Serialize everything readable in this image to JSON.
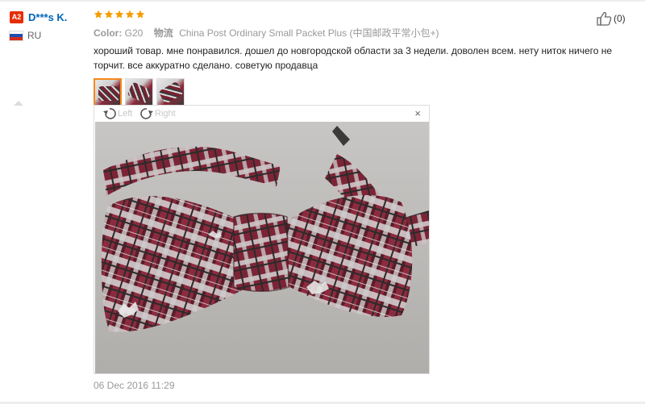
{
  "user": {
    "level_badge": "A2",
    "name": "D***s K.",
    "country": "RU"
  },
  "review": {
    "rating": 5,
    "color_label": "Color:",
    "color_value": "G20",
    "shipping_label": "物流",
    "shipping_value": "China Post Ordinary Small Packet Plus (中国邮政平常小包+)",
    "text": "хороший товар. мне понравился. дошел до новгородской области за 3 недели. доволен всем. нету ниток ничего не торчит. все аккуратно сделано. советую продавца",
    "date": "06 Dec 2016 11:29"
  },
  "viewer": {
    "rotate_left_label": "Left",
    "rotate_right_label": "Right",
    "close_symbol": "×"
  },
  "helpful": {
    "count_text": "(0)"
  },
  "thumbnails": [
    "photo-1",
    "photo-2",
    "photo-3"
  ],
  "icons": {
    "star": "star-icon",
    "thumbs_up": "thumbs-up-icon",
    "rotate_left": "rotate-left-icon",
    "rotate_right": "rotate-right-icon",
    "close": "close-icon",
    "flag": "russia-flag-icon"
  },
  "colors": {
    "star": "#f59d00",
    "name_link": "#0066b8",
    "badge": "#e62e04",
    "thumb_active_border": "#f48a1d",
    "tie_burgundy": "#7a1f30"
  }
}
